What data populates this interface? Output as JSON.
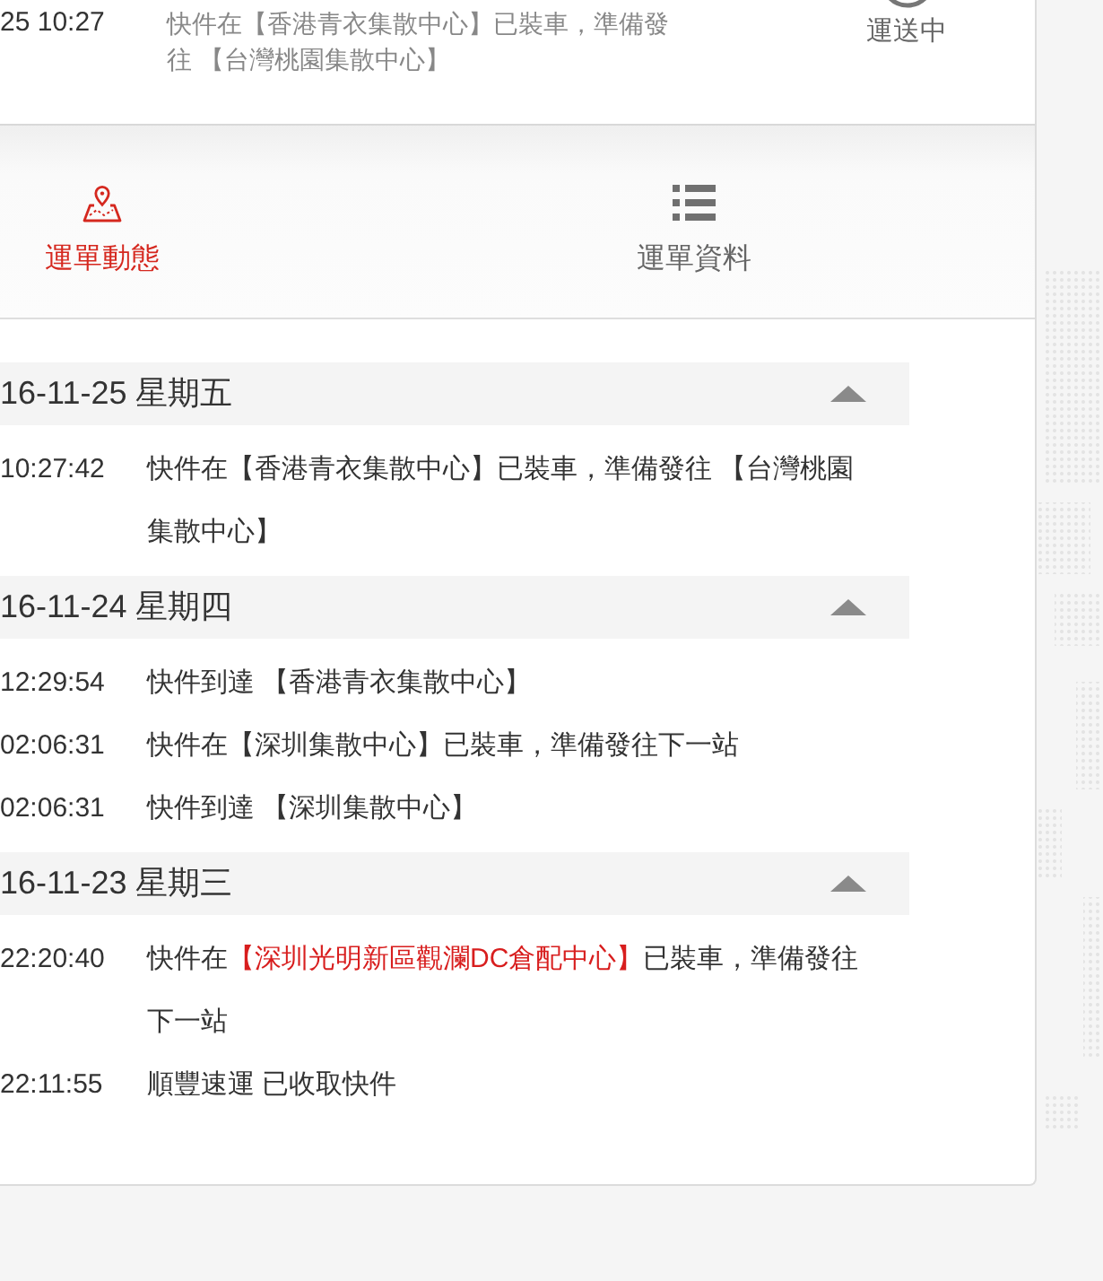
{
  "shipment_summary": {
    "time": "25 10:27",
    "description": "快件在【香港青衣集散中心】已裝車，準備發往 【台灣桃園集散中心】",
    "status": "運送中"
  },
  "tabs": [
    {
      "label": "運單動態",
      "selected": true
    },
    {
      "label": "運單資料",
      "selected": false
    }
  ],
  "timeline": [
    {
      "date": "16-11-25 星期五",
      "expanded": true,
      "events": [
        {
          "time": "10:27:42",
          "segments": [
            {
              "text": "快件在【香港青衣集散中心】已裝車，準備發往 【台灣桃園集散中心】",
              "highlighted": false
            }
          ]
        }
      ]
    },
    {
      "date": "16-11-24 星期四",
      "expanded": true,
      "events": [
        {
          "time": "12:29:54",
          "segments": [
            {
              "text": "快件到達 【香港青衣集散中心】",
              "highlighted": false
            }
          ]
        },
        {
          "time": "02:06:31",
          "segments": [
            {
              "text": "快件在【深圳集散中心】已裝車，準備發往下一站",
              "highlighted": false
            }
          ]
        },
        {
          "time": "02:06:31",
          "segments": [
            {
              "text": "快件到達 【深圳集散中心】",
              "highlighted": false
            }
          ]
        }
      ]
    },
    {
      "date": "16-11-23 星期三",
      "expanded": true,
      "events": [
        {
          "time": "22:20:40",
          "segments": [
            {
              "text": "快件在",
              "highlighted": false
            },
            {
              "text": "【深圳光明新區觀瀾DC倉配中心】",
              "highlighted": true
            },
            {
              "text": "已裝車，準備發往下一站",
              "highlighted": false
            }
          ]
        },
        {
          "time": "22:11:55",
          "segments": [
            {
              "text": "順豐速運 已收取快件",
              "highlighted": false
            }
          ]
        }
      ]
    }
  ]
}
